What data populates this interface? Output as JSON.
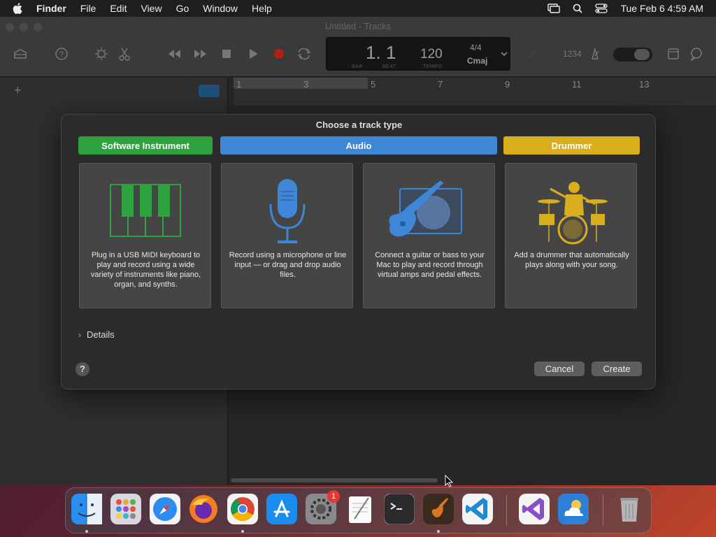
{
  "menubar": {
    "app": "Finder",
    "items": [
      "File",
      "Edit",
      "View",
      "Go",
      "Window",
      "Help"
    ],
    "datetime": "Tue Feb 6  4:59 AM"
  },
  "window": {
    "title": "Untitled - Tracks",
    "lcd": {
      "position": "1. 1",
      "bar_label": "BAR",
      "beat_label": "BEAT",
      "tempo": "120",
      "tempo_label": "TEMPO",
      "signature": "4/4",
      "key": "Cmaj",
      "count_in": "1234"
    },
    "ruler": [
      "1",
      "3",
      "5",
      "7",
      "9",
      "11",
      "13"
    ]
  },
  "dialog": {
    "title": "Choose a track type",
    "categories": {
      "software_instrument": "Software Instrument",
      "audio": "Audio",
      "drummer": "Drummer"
    },
    "cards": [
      {
        "desc": "Plug in a USB MIDI keyboard to play and record using a wide variety of instruments like piano, organ, and synths."
      },
      {
        "desc": "Record using a microphone or line input — or drag and drop audio files."
      },
      {
        "desc": "Connect a guitar or bass to your Mac to play and record through virtual amps and pedal effects."
      },
      {
        "desc": "Add a drummer that automatically plays along with your song."
      }
    ],
    "details": "Details",
    "help": "?",
    "cancel": "Cancel",
    "create": "Create"
  },
  "dock": {
    "badge": "1"
  },
  "colors": {
    "software_instrument": "#2ea23f",
    "audio": "#3e86d6",
    "drummer": "#d9ae1c"
  }
}
